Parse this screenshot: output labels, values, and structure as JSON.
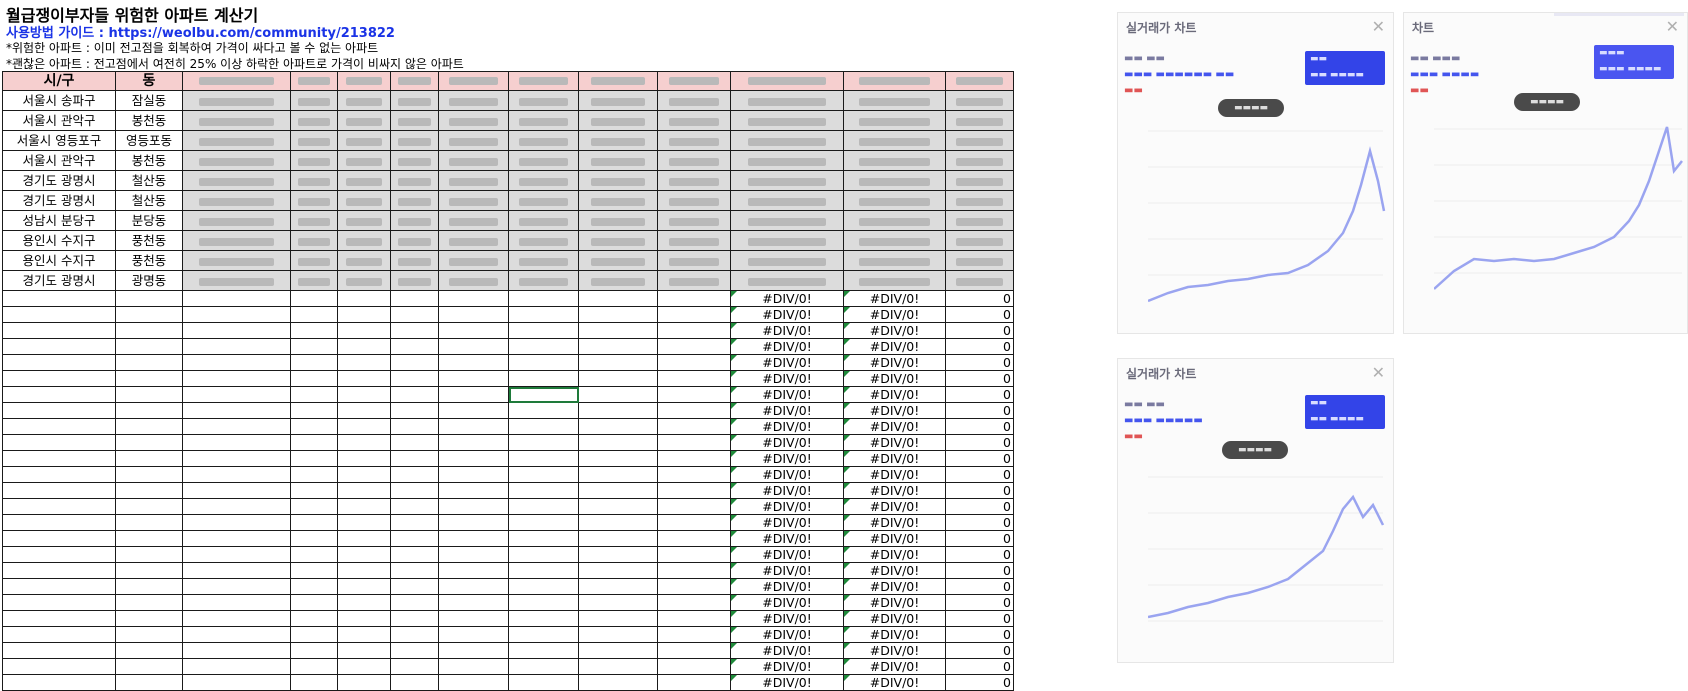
{
  "header": {
    "title": "월급쟁이부자들 위험한 아파트 계산기",
    "guide": "사용방법 가이드 : https://weolbu.com/community/213822",
    "note1": "*위험한 아파트 : 이미 전고점을 회복하여 가격이 싸다고 볼 수 없는 아파트",
    "note2": "*괜찮은 아파트 : 전고점에서 여전히 25% 이상 하락한 아파트로 가격이 비싸지 않은 아파트"
  },
  "table": {
    "columns": [
      "시/구",
      "동"
    ],
    "rows": [
      {
        "city": "서울시 송파구",
        "dong": "잠실동"
      },
      {
        "city": "서울시 관악구",
        "dong": "봉천동"
      },
      {
        "city": "서울시 영등포구",
        "dong": "영등포동"
      },
      {
        "city": "서울시 관악구",
        "dong": "봉천동"
      },
      {
        "city": "경기도 광명시",
        "dong": "철산동"
      },
      {
        "city": "경기도 광명시",
        "dong": "철산동"
      },
      {
        "city": "성남시 분당구",
        "dong": "분당동"
      },
      {
        "city": "용인시 수지구",
        "dong": "풍천동"
      },
      {
        "city": "용인시 수지구",
        "dong": "풍천동"
      },
      {
        "city": "경기도 광명시",
        "dong": "광명동"
      }
    ],
    "error_value": "#DIV/0!",
    "zero_value": "0"
  },
  "charts": [
    {
      "title": "실거래가 차트"
    },
    {
      "title": "차트"
    },
    {
      "title": "실거래가 차트"
    }
  ]
}
